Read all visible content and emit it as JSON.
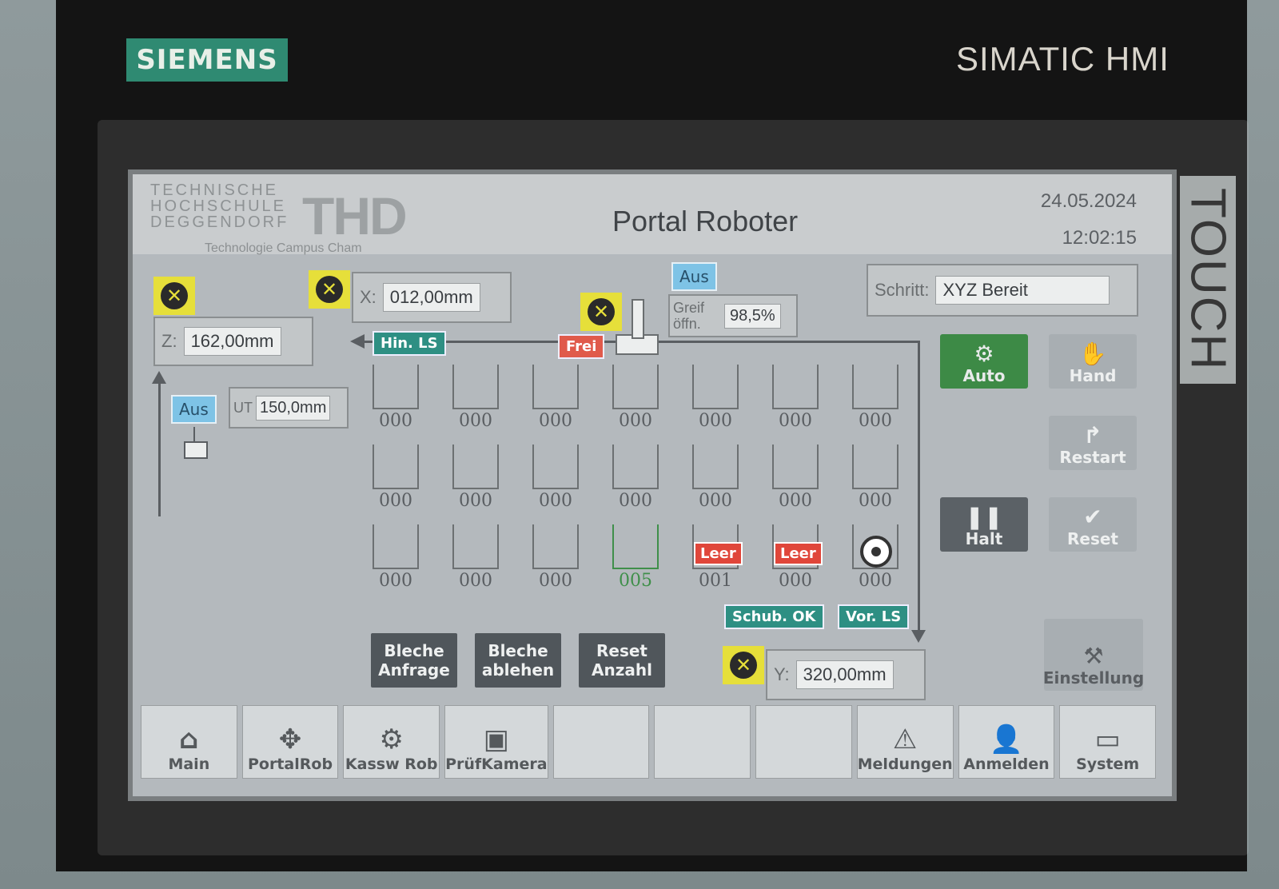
{
  "hardware": {
    "brand": "SIEMENS",
    "model": "SIMATIC HMI",
    "touch_label": "TOUCH"
  },
  "header": {
    "logo_lines": [
      "TECHNISCHE",
      "HOCHSCHULE",
      "DEGGENDORF"
    ],
    "logo_mark": "THD",
    "logo_sub": "Technologie Campus Cham",
    "title": "Portal Roboter",
    "date": "24.05.2024",
    "time": "12:02:15"
  },
  "axes": {
    "x": {
      "label": "X:",
      "value": "012,00mm"
    },
    "z": {
      "label": "Z:",
      "value": "162,00mm"
    },
    "y": {
      "label": "Y:",
      "value": "320,00mm"
    },
    "ut": {
      "label": "UT",
      "value": "150,0mm"
    },
    "z_state": "Aus"
  },
  "gripper": {
    "state": "Aus",
    "label": "Greif öffn.",
    "value": "98,5%"
  },
  "status_tags": {
    "hin_ls": "Hin. LS",
    "frei": "Frei",
    "schub_ok": "Schub. OK",
    "vor_ls": "Vor. LS"
  },
  "step": {
    "label": "Schritt:",
    "value": "XYZ Bereit"
  },
  "grid": {
    "rows": [
      [
        "000",
        "000",
        "000",
        "000",
        "000",
        "000",
        "000"
      ],
      [
        "000",
        "000",
        "000",
        "000",
        "000",
        "000",
        "000"
      ],
      [
        "000",
        "000",
        "000",
        "005",
        "001",
        "000",
        "000"
      ]
    ],
    "leer_label": "Leer"
  },
  "mode_buttons": {
    "auto": "Auto",
    "hand": "Hand",
    "restart": "Restart",
    "halt": "Halt",
    "reset": "Reset",
    "einstellung": "Einstellung"
  },
  "cmd_buttons": [
    {
      "l1": "Bleche",
      "l2": "Anfrage"
    },
    {
      "l1": "Bleche",
      "l2": "ablehen"
    },
    {
      "l1": "Reset",
      "l2": "Anzahl"
    }
  ],
  "nav": [
    {
      "label": "Main",
      "icon": "home-icon",
      "glyph": "⌂"
    },
    {
      "label": "PortalRob",
      "icon": "move-icon",
      "glyph": "✥"
    },
    {
      "label": "Kassw Rob",
      "icon": "robot-arm-icon",
      "glyph": "⚙"
    },
    {
      "label": "PrüfKamera",
      "icon": "camera-icon",
      "glyph": "▣"
    },
    {
      "label": "",
      "icon": "",
      "glyph": ""
    },
    {
      "label": "",
      "icon": "",
      "glyph": ""
    },
    {
      "label": "",
      "icon": "",
      "glyph": ""
    },
    {
      "label": "Meldungen",
      "icon": "warning-icon",
      "glyph": "⚠"
    },
    {
      "label": "Anmelden",
      "icon": "user-icon",
      "glyph": "👤"
    },
    {
      "label": "System",
      "icon": "system-icon",
      "glyph": "▭"
    }
  ]
}
